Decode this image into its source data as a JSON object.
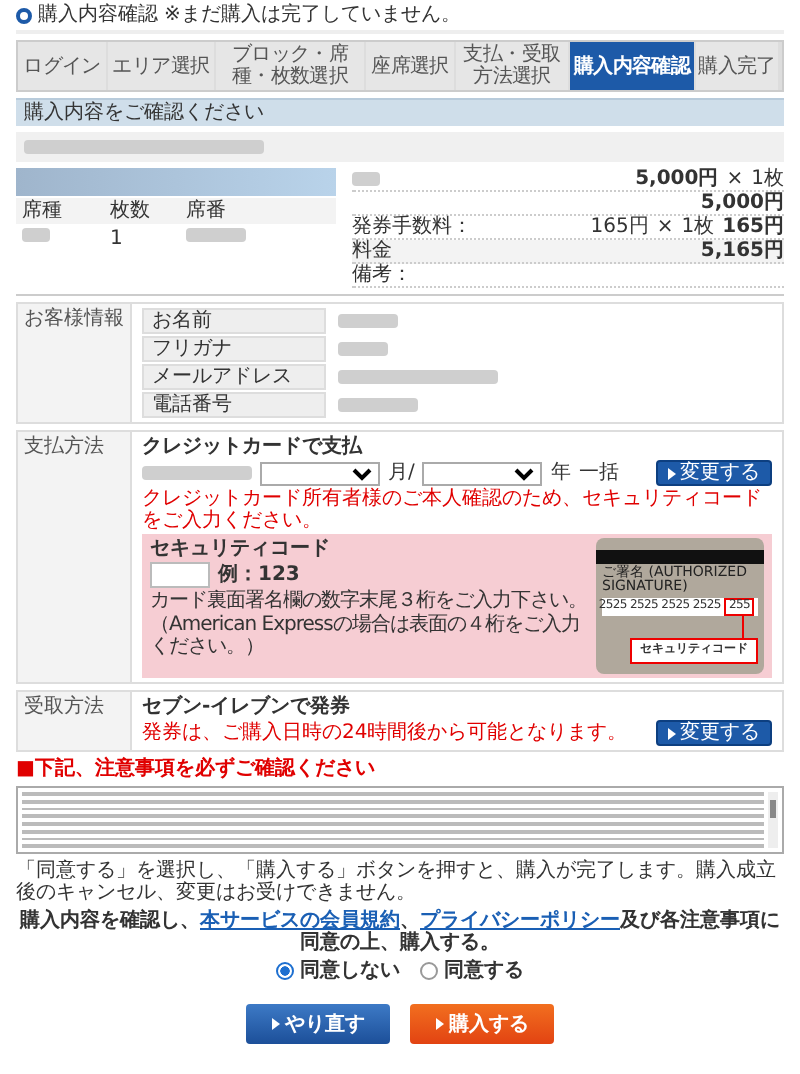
{
  "page_title": "購入内容確認",
  "page_notice": "※まだ購入は完了していません。",
  "steps": [
    {
      "label": "ログイン",
      "selected": false
    },
    {
      "label": "エリア選択",
      "selected": false
    },
    {
      "label": "ブロック・席種・枚数選択",
      "selected": false
    },
    {
      "label": "座席選択",
      "selected": false
    },
    {
      "label": "支払・受取方法選択",
      "selected": false
    },
    {
      "label": "購入内容確認",
      "selected": true
    },
    {
      "label": "購入完了",
      "selected": false
    }
  ],
  "confirm_header": "購入内容をご確認ください",
  "ticket": {
    "columns": [
      "席種",
      "枚数",
      "席番"
    ],
    "count": "1",
    "price": {
      "unit_price": "5,000円",
      "times": "×",
      "quantity": "1枚",
      "subtotal": "5,000円"
    },
    "fee": {
      "label": "発券手数料：",
      "unit_price": "165円",
      "times": "×",
      "quantity": "1枚",
      "amount": "165円"
    },
    "total": {
      "label": "料金",
      "amount": "5,165円"
    },
    "remarks_label": "備考："
  },
  "customer": {
    "heading": "お客様情報",
    "fields": [
      "お名前",
      "フリガナ",
      "メールアドレス",
      "電話番号"
    ]
  },
  "payment": {
    "heading": "支払方法",
    "method": "クレジットカードで支払",
    "month_suffix": "月/",
    "year_suffix": "年",
    "installment": "一括",
    "change_button": "変更する",
    "warning": "クレジットカード所有者様のご本人確認のため、セキュリティコードをご入力ください。",
    "security": {
      "title": "セキュリティコード",
      "example": "例：123",
      "hint": "カード裏面署名欄の数字末尾３桁をご入力下さい。",
      "amex_hint": "（American Expressの場合は表面の４桁をご入力ください。）",
      "card": {
        "signature_label": "ご署名 (AUTHORIZED SIGNATURE)",
        "numbers": "2525 2525 2525 2525",
        "code": "255",
        "callout": "セキュリティコード"
      }
    }
  },
  "delivery": {
    "heading": "受取方法",
    "method": "セブン-イレブンで発券",
    "note": "発券は、ご購入日時の24時間後から可能となります。",
    "change_button": "変更する"
  },
  "notes_heading": "■下記、注意事項を必ずご確認ください",
  "agree_notice": "「同意する」を選択し、「購入する」ボタンを押すと、購入が完了します。購入成立後のキャンセル、変更はお受けできません。",
  "agreement": [
    {
      "kind": "text",
      "text": "購入内容を確認し、"
    },
    {
      "kind": "link",
      "text": "本サービスの会員規約"
    },
    {
      "kind": "text",
      "text": "、"
    },
    {
      "kind": "link",
      "text": "プライバシーポリシー"
    },
    {
      "kind": "text",
      "text": "及び各注意事項に同意の上、購入する。"
    }
  ],
  "consent_options": [
    {
      "label": "同意しない",
      "selected": true
    },
    {
      "label": "同意する",
      "selected": false
    }
  ],
  "buttons": [
    {
      "label": "やり直す",
      "kind": "secondary"
    },
    {
      "label": "購入する",
      "kind": "primary"
    }
  ]
}
